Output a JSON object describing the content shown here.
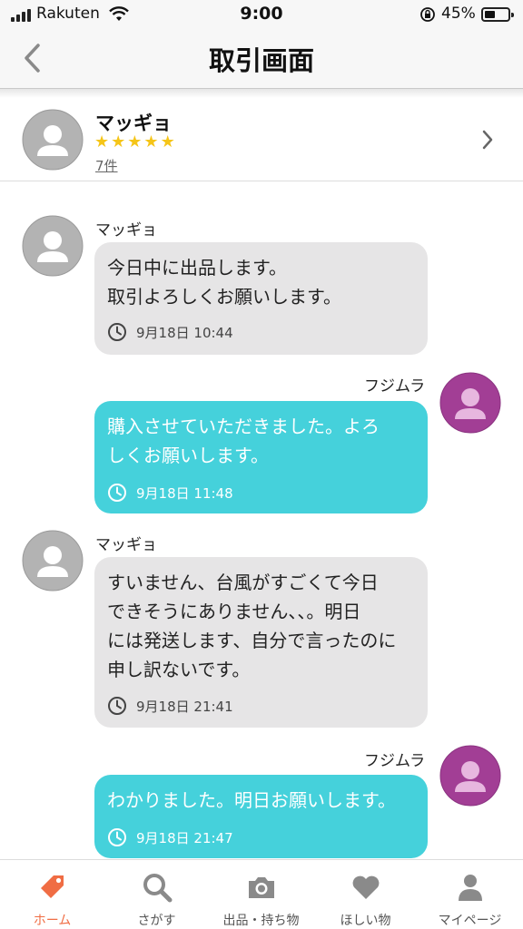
{
  "status_bar": {
    "carrier": "Rakuten",
    "time": "9:00",
    "battery": "45%",
    "battery_level": 0.45
  },
  "nav": {
    "title": "取引画面",
    "back_icon": "chevron-left-icon"
  },
  "seller": {
    "name": "マッギョ",
    "rating_stars": 5,
    "review_count": "7件"
  },
  "messages": [
    {
      "sender": "マッギョ",
      "side": "other",
      "text": "今日中に出品します。\n取引よろしくお願いします。",
      "time": "9月18日 10:44"
    },
    {
      "sender": "フジムラ",
      "side": "mine",
      "text": "購入させていただきました。よろ\nしくお願いします。",
      "time": "9月18日 11:48"
    },
    {
      "sender": "マッギョ",
      "side": "other",
      "text": "すいません、台風がすごくて今日\nできそうにありません、、。明日\nには発送します、自分で言ったのに\n申し訳ないです。",
      "time": "9月18日 21:41"
    },
    {
      "sender": "フジムラ",
      "side": "mine",
      "text": "わかりました。明日お願いします。",
      "time": "9月18日 21:47"
    }
  ],
  "tabbar": {
    "tabs": [
      {
        "label": "ホーム",
        "icon": "price-tag-icon",
        "active": true
      },
      {
        "label": "さがす",
        "icon": "search-icon",
        "active": false
      },
      {
        "label": "出品・持ち物",
        "icon": "camera-icon",
        "active": false
      },
      {
        "label": "ほしい物",
        "icon": "heart-icon",
        "active": false
      },
      {
        "label": "マイページ",
        "icon": "person-icon",
        "active": false
      }
    ]
  },
  "colors": {
    "accent": "#f06d44",
    "my_bubble": "#45d1db",
    "other_bubble": "#e6e5e6",
    "star": "#f5c518",
    "my_avatar": "#a23e95",
    "default_avatar": "#b3b3b3"
  }
}
